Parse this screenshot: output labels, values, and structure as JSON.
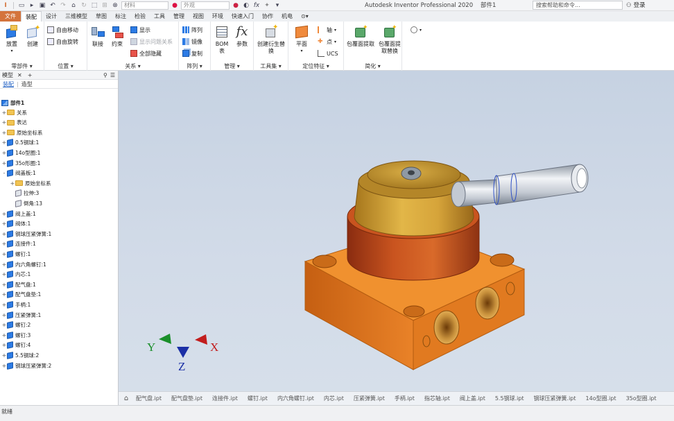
{
  "titlebar": {
    "app_title": "Autodesk Inventor Professional 2020",
    "doc_name": "部件1",
    "material_placeholder": "材料",
    "appearance_placeholder": "外观",
    "search_text": "搜索帮助和命令...",
    "login_label": "登录"
  },
  "tabs": [
    "文件",
    "装配",
    "设计",
    "三维模型",
    "草图",
    "标注",
    "检验",
    "工具",
    "管理",
    "视图",
    "环境",
    "快速入门",
    "协作",
    "机电"
  ],
  "active_tab": "装配",
  "ribbon": {
    "component": {
      "place": "放置",
      "create": "创建",
      "panel_label": "零部件"
    },
    "position": {
      "free_move": "自由移动",
      "free_rotate": "自由旋转",
      "panel_label": "位置"
    },
    "relationships": {
      "join": "联接",
      "constrain": "约束",
      "show": "显示",
      "show_problem": "显示问题关系",
      "hide_all": "全部隐藏",
      "panel_label": "关系"
    },
    "pattern": {
      "pattern": "阵列",
      "mirror": "镜像",
      "copy": "复制",
      "panel_label": "阵列"
    },
    "manage": {
      "bom": "BOM 表",
      "params": "参数",
      "panel_label": "管理"
    },
    "productivity": {
      "create_substitute": "创建衍生替换",
      "panel_label": "工具集"
    },
    "work_features": {
      "plane": "平面",
      "axis": "轴",
      "point": "点",
      "ucs": "UCS",
      "panel_label": "定位特征"
    },
    "simplification": {
      "shrinkwrap": "包覆面提取",
      "shrinkwrap_sub": "包覆面提取替换",
      "panel_label": "简化"
    }
  },
  "browser": {
    "title": "模型",
    "subtabs": [
      "装配",
      "造型"
    ],
    "root": "部件1",
    "items": [
      {
        "label": "关系",
        "icon": "folder",
        "toggle": "+"
      },
      {
        "label": "表达",
        "icon": "folder",
        "toggle": "+"
      },
      {
        "label": "原始坐标系",
        "icon": "folder",
        "toggle": "+"
      },
      {
        "label": "0.5钢球:1",
        "icon": "part",
        "toggle": "+"
      },
      {
        "label": "14o型圈:1",
        "icon": "part",
        "toggle": "+"
      },
      {
        "label": "35o形圈:1",
        "icon": "part",
        "toggle": "+"
      },
      {
        "label": "阀盖板:1",
        "icon": "part",
        "toggle": "-"
      },
      {
        "label": "原始坐标系",
        "icon": "folder",
        "toggle": "+",
        "indent": 1
      },
      {
        "label": "拉伸:3",
        "icon": "feature",
        "toggle": "",
        "indent": 1
      },
      {
        "label": "倒角:13",
        "icon": "feature",
        "toggle": "",
        "indent": 1
      },
      {
        "label": "阀上盖:1",
        "icon": "part",
        "toggle": "+"
      },
      {
        "label": "阀体:1",
        "icon": "part",
        "toggle": "+"
      },
      {
        "label": "钢球压紧弹簧:1",
        "icon": "part",
        "toggle": "+"
      },
      {
        "label": "连接件:1",
        "icon": "part",
        "toggle": "+"
      },
      {
        "label": "螺钉:1",
        "icon": "part",
        "toggle": "+"
      },
      {
        "label": "内六角螺钉:1",
        "icon": "part",
        "toggle": "+"
      },
      {
        "label": "内芯:1",
        "icon": "part",
        "toggle": "+"
      },
      {
        "label": "配气盘:1",
        "icon": "part",
        "toggle": "+"
      },
      {
        "label": "配气盘垫:1",
        "icon": "part",
        "toggle": "+"
      },
      {
        "label": "手柄:1",
        "icon": "part",
        "toggle": "+"
      },
      {
        "label": "压紧弹簧:1",
        "icon": "part",
        "toggle": "+"
      },
      {
        "label": "螺钉:2",
        "icon": "part",
        "toggle": "+"
      },
      {
        "label": "螺钉:3",
        "icon": "part",
        "toggle": "+"
      },
      {
        "label": "螺钉:4",
        "icon": "part",
        "toggle": "+"
      },
      {
        "label": "5.5钢球:2",
        "icon": "part",
        "toggle": "+"
      },
      {
        "label": "钢球压紧弹簧:2",
        "icon": "part",
        "toggle": "+"
      }
    ]
  },
  "triad": {
    "x": "X",
    "y": "Y",
    "z": "Z"
  },
  "doc_tabs": [
    "配气盘.ipt",
    "配气盘垫.ipt",
    "连接件.ipt",
    "螺钉.ipt",
    "内六角螺钉.ipt",
    "内芯.ipt",
    "压紧弹簧.ipt",
    "手柄.ipt",
    "指芯轴.ipt",
    "阀上盖.ipt",
    "5.5钢球.ipt",
    "钢球压紧弹簧.ipt",
    "14o型圈.ipt",
    "35o型圈.ipt"
  ],
  "status": "就绪",
  "colors": {
    "file_tab": "#d4743c",
    "viewport_top": "#c6d2e2",
    "body_orange": "#e07a1f",
    "cap_gold": "#c89a2e",
    "ring_red": "#b4461c"
  }
}
